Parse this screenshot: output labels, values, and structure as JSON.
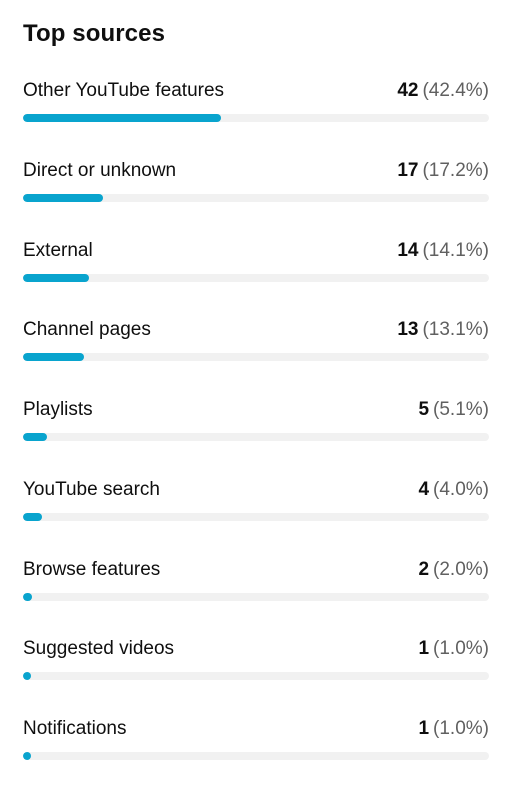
{
  "title": "Top sources",
  "accent_color": "#09a4ce",
  "sources": [
    {
      "label": "Other YouTube features",
      "count": "42",
      "percent": "(42.4%)",
      "share": 0.424
    },
    {
      "label": "Direct or unknown",
      "count": "17",
      "percent": "(17.2%)",
      "share": 0.172
    },
    {
      "label": "External",
      "count": "14",
      "percent": "(14.1%)",
      "share": 0.141
    },
    {
      "label": "Channel pages",
      "count": "13",
      "percent": "(13.1%)",
      "share": 0.131
    },
    {
      "label": "Playlists",
      "count": "5",
      "percent": "(5.1%)",
      "share": 0.051
    },
    {
      "label": "YouTube search",
      "count": "4",
      "percent": "(4.0%)",
      "share": 0.04
    },
    {
      "label": "Browse features",
      "count": "2",
      "percent": "(2.0%)",
      "share": 0.02
    },
    {
      "label": "Suggested videos",
      "count": "1",
      "percent": "(1.0%)",
      "share": 0.01
    },
    {
      "label": "Notifications",
      "count": "1",
      "percent": "(1.0%)",
      "share": 0.01
    }
  ]
}
